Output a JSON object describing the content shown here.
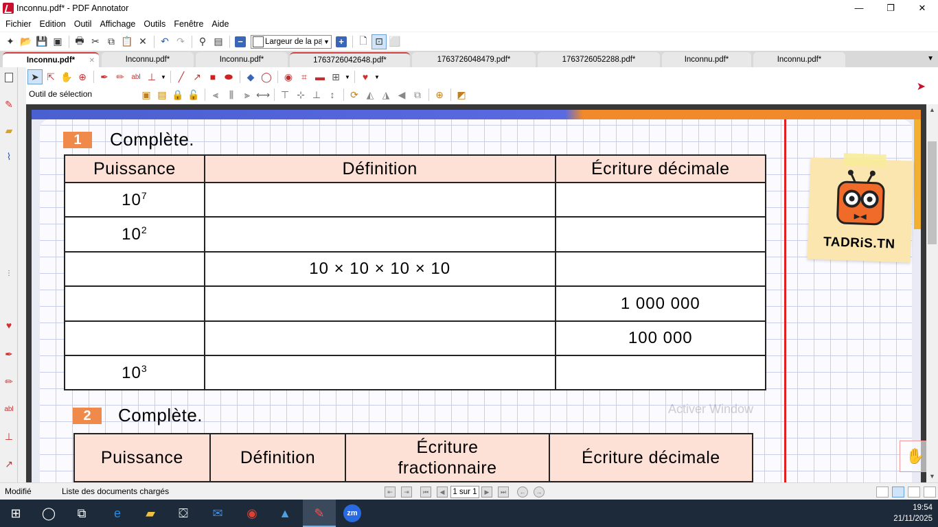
{
  "window": {
    "title": "Inconnu.pdf* - PDF Annotator",
    "controls": {
      "minimize": "—",
      "maximize": "❐",
      "close": "✕"
    }
  },
  "menu": [
    "Fichier",
    "Edition",
    "Outil",
    "Affichage",
    "Outils",
    "Fenêtre",
    "Aide"
  ],
  "toolbar": {
    "zoom_value": "Largeur de la pa"
  },
  "tabs": [
    {
      "label": "Inconnu.pdf*",
      "active": true
    },
    {
      "label": "Inconnu.pdf*"
    },
    {
      "label": "Inconnu.pdf*"
    },
    {
      "label": "1763726042648.pdf*"
    },
    {
      "label": "1763726048479.pdf*"
    },
    {
      "label": "1763726052288.pdf*"
    },
    {
      "label": "Inconnu.pdf*"
    },
    {
      "label": "Inconnu.pdf*"
    }
  ],
  "tools": {
    "current_tool_label": "Outil de sélection"
  },
  "document": {
    "exercise1": {
      "number": "1",
      "title": "Complète.",
      "headers": [
        "Puissance",
        "Définition",
        "Écriture décimale"
      ],
      "rows": [
        {
          "base": "10",
          "exp": "7",
          "definition": "",
          "decimal": ""
        },
        {
          "base": "10",
          "exp": "2",
          "definition": "",
          "decimal": ""
        },
        {
          "base": "",
          "exp": "",
          "definition": "10 × 10 × 10 × 10",
          "decimal": ""
        },
        {
          "base": "",
          "exp": "",
          "definition": "",
          "decimal": "1 000 000"
        },
        {
          "base": "",
          "exp": "",
          "definition": "",
          "decimal": "100 000"
        },
        {
          "base": "10",
          "exp": "3",
          "definition": "",
          "decimal": ""
        }
      ]
    },
    "exercise2": {
      "number": "2",
      "title": "Complète.",
      "headers": [
        "Puissance",
        "Définition",
        "Écriture\nfractionnaire",
        "Écriture décimale"
      ]
    },
    "logo_text": "TADRiS.TN",
    "watermark": "Activer Window"
  },
  "status": {
    "state": "Modifié",
    "docs_list": "Liste des documents chargés",
    "page_indicator": "1 sur 1"
  },
  "taskbar": {
    "time": "19:54",
    "date": "21/11/2025"
  },
  "colors": {
    "accent_red": "#c8102e",
    "header_fill": "#fde0d6",
    "exercise_badge": "#f08a4a",
    "margin_line": "#e02020"
  }
}
